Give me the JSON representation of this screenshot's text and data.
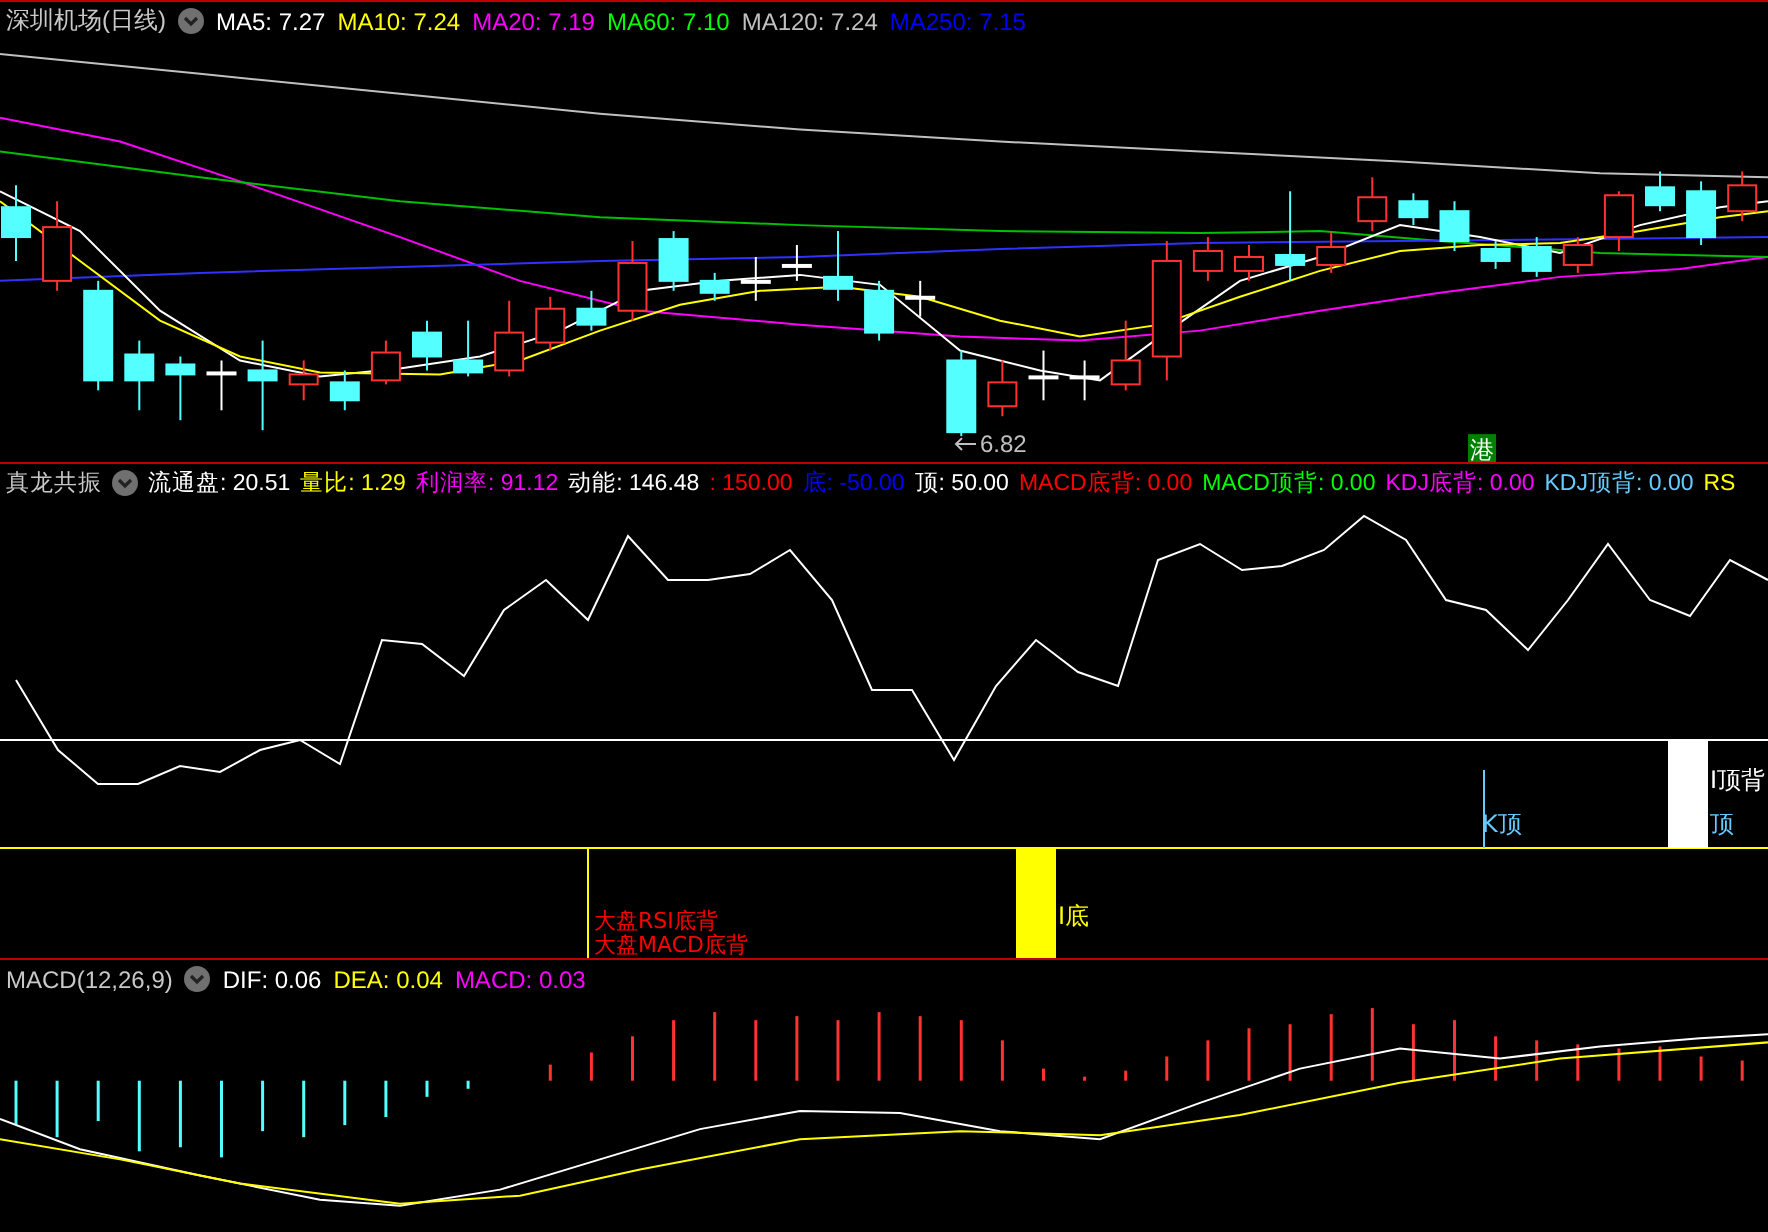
{
  "main_chart": {
    "title": "深圳机场(日线)",
    "indicators": [
      {
        "text": "MA5: 7.27",
        "color": "#ffffff"
      },
      {
        "text": "MA10: 7.24",
        "color": "#ffff00"
      },
      {
        "text": "MA20: 7.19",
        "color": "#ff00ff"
      },
      {
        "text": "MA60: 7.10",
        "color": "#00ff00"
      },
      {
        "text": "MA120: 7.24",
        "color": "#c0c0c0"
      },
      {
        "text": "MA250: 7.15",
        "color": "#0000ff"
      }
    ],
    "low_marker": "6.82",
    "badge": "港"
  },
  "indicator_panel": {
    "title": "真龙共振",
    "values": [
      {
        "text": "流通盘: 20.51",
        "color": "#ffffff"
      },
      {
        "text": "量比: 1.29",
        "color": "#ffff00"
      },
      {
        "text": "利润率: 91.12",
        "color": "#ff00ff"
      },
      {
        "text": "动能: 146.48",
        "color": "#ffffff"
      },
      {
        "text": ": 150.00",
        "color": "#ff0000"
      },
      {
        "text": "底: -50.00",
        "color": "#0000ff"
      },
      {
        "text": "顶: 50.00",
        "color": "#ffffff"
      },
      {
        "text": "MACD底背: 0.00",
        "color": "#ff0000"
      },
      {
        "text": "MACD顶背: 0.00",
        "color": "#00ff00"
      },
      {
        "text": "KDJ底背: 0.00",
        "color": "#ff00ff"
      },
      {
        "text": "KDJ顶背: 0.00",
        "color": "#66ccff"
      },
      {
        "text": "RS",
        "color": "#ffff00"
      }
    ],
    "labels": [
      {
        "text": "大盘RSI底背",
        "color": "#ff0000"
      },
      {
        "text": "大盘MACD底背",
        "color": "#ff0000"
      },
      {
        "text": "I底",
        "color": "#ffff00"
      },
      {
        "text": "K顶",
        "color": "#66ccff"
      },
      {
        "text": "I顶背",
        "color": "#ffffff"
      },
      {
        "text": "顶",
        "color": "#66ccff"
      }
    ]
  },
  "macd_panel": {
    "title": "MACD(12,26,9)",
    "values": [
      {
        "text": "DIF: 0.06",
        "color": "#ffffff"
      },
      {
        "text": "DEA: 0.04",
        "color": "#ffff00"
      },
      {
        "text": "MACD: 0.03",
        "color": "#ff00ff"
      }
    ]
  }
}
